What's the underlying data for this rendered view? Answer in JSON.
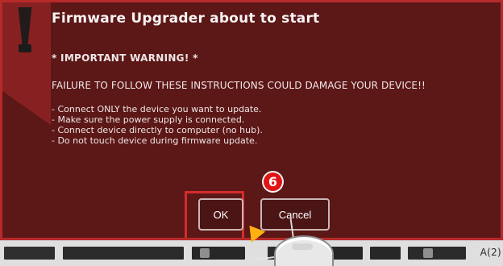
{
  "dialog": {
    "title": "Firmware Upgrader about to start",
    "important": "* IMPORTANT WARNING! *",
    "failure": "FAILURE TO FOLLOW THESE INSTRUCTIONS COULD DAMAGE YOUR DEVICE!!",
    "steps": [
      "- Connect ONLY the device you want to update.",
      "- Make sure the power supply is connected.",
      "- Connect device directly to computer (no hub).",
      "- Do not touch device during firmware update."
    ],
    "buttons": {
      "ok": "OK",
      "cancel": "Cancel"
    },
    "step_badge": "6"
  },
  "taskbar": {
    "clock": "A(2)"
  },
  "colors": {
    "dialog_background": "#5c1717",
    "dialog_border": "#b62a2a",
    "highlight": "#d52c2c",
    "badge": "#e11414",
    "pointer": "#ffb114"
  },
  "icons": {
    "warning": "warning-icon",
    "pointer": "pointer-arrow-icon",
    "mouse": "mouse-icon"
  }
}
